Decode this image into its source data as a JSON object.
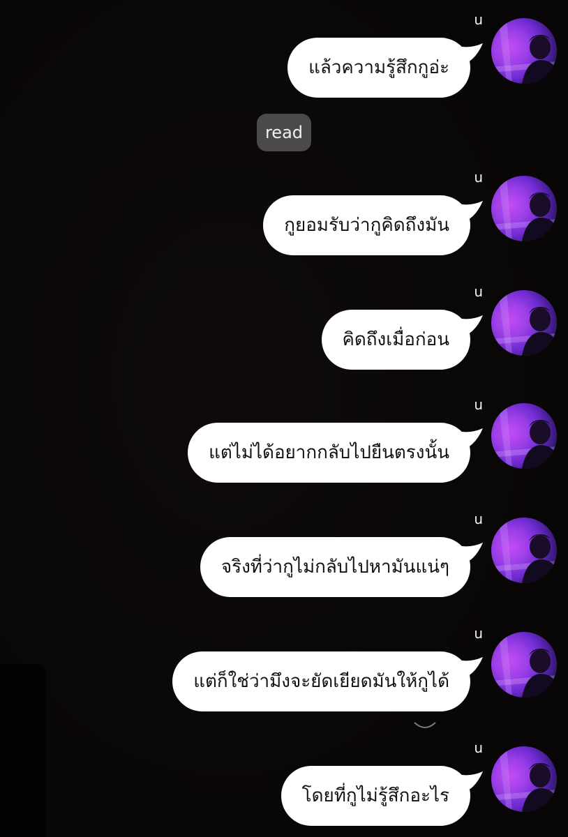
{
  "chat": {
    "read_label": "read",
    "messages": [
      {
        "sender": "u",
        "text": "แล้วความรู้สึกกูอ่ะ"
      },
      {
        "sender": "u",
        "text": "กูยอมรับว่ากูคิดถึงมัน"
      },
      {
        "sender": "u",
        "text": "คิดถึงเมื่อก่อน"
      },
      {
        "sender": "u",
        "text": "แต่ไม่ได้อยากกลับไปยืนตรงนั้น"
      },
      {
        "sender": "u",
        "text": "จริงที่ว่ากูไม่กลับไปหามันแน่ๆ"
      },
      {
        "sender": "u",
        "text": "แต่ก็ใช่ว่ามึงจะยัดเยียดมันให้กูได้"
      },
      {
        "sender": "u",
        "text": "โดยที่กูไม่รู้สึกอะไร"
      }
    ]
  },
  "colors": {
    "background": "#0a0707",
    "bubble": "#ffffff",
    "bubble_text": "#111111",
    "read_chip": "#4c4a49",
    "avatar_accent": "#9d3fe8"
  }
}
